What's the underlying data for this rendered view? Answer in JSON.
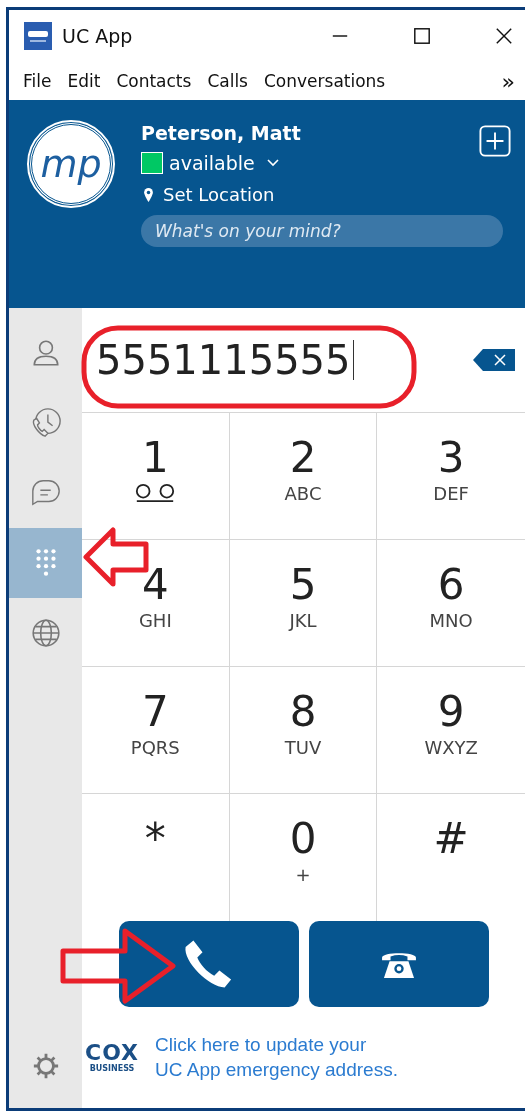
{
  "window": {
    "title": "UC App"
  },
  "menu": {
    "items": [
      "File",
      "Edit",
      "Contacts",
      "Calls",
      "Conversations"
    ],
    "overflow": "»"
  },
  "profile": {
    "initials": "mp",
    "name": "Peterson, Matt",
    "status": {
      "label": "available",
      "color": "#00c864"
    },
    "location": "Set Location",
    "mood": {
      "placeholder": "What's on your mind?"
    }
  },
  "sidebar": {
    "items": [
      {
        "kind": "contacts",
        "selected": false
      },
      {
        "kind": "history",
        "selected": false
      },
      {
        "kind": "chat",
        "selected": false
      },
      {
        "kind": "dialpad",
        "selected": true
      },
      {
        "kind": "globe",
        "selected": false
      }
    ]
  },
  "dialer": {
    "number": "5551115555",
    "keys": [
      {
        "digit": "1",
        "kind": "voicemail"
      },
      {
        "digit": "2",
        "letters": "ABC"
      },
      {
        "digit": "3",
        "letters": "DEF"
      },
      {
        "digit": "4",
        "letters": "GHI"
      },
      {
        "digit": "5",
        "letters": "JKL"
      },
      {
        "digit": "6",
        "letters": "MNO"
      },
      {
        "digit": "7",
        "letters": "PQRS"
      },
      {
        "digit": "8",
        "letters": "TUV"
      },
      {
        "digit": "9",
        "letters": "WXYZ"
      },
      {
        "digit": "*"
      },
      {
        "digit": "0",
        "letters": "+"
      },
      {
        "digit": "#"
      }
    ]
  },
  "footer": {
    "logo": "COX",
    "logo_sub": "BUSINESS",
    "link_lines": [
      "Click here to update your",
      "UC App emergency address."
    ]
  }
}
